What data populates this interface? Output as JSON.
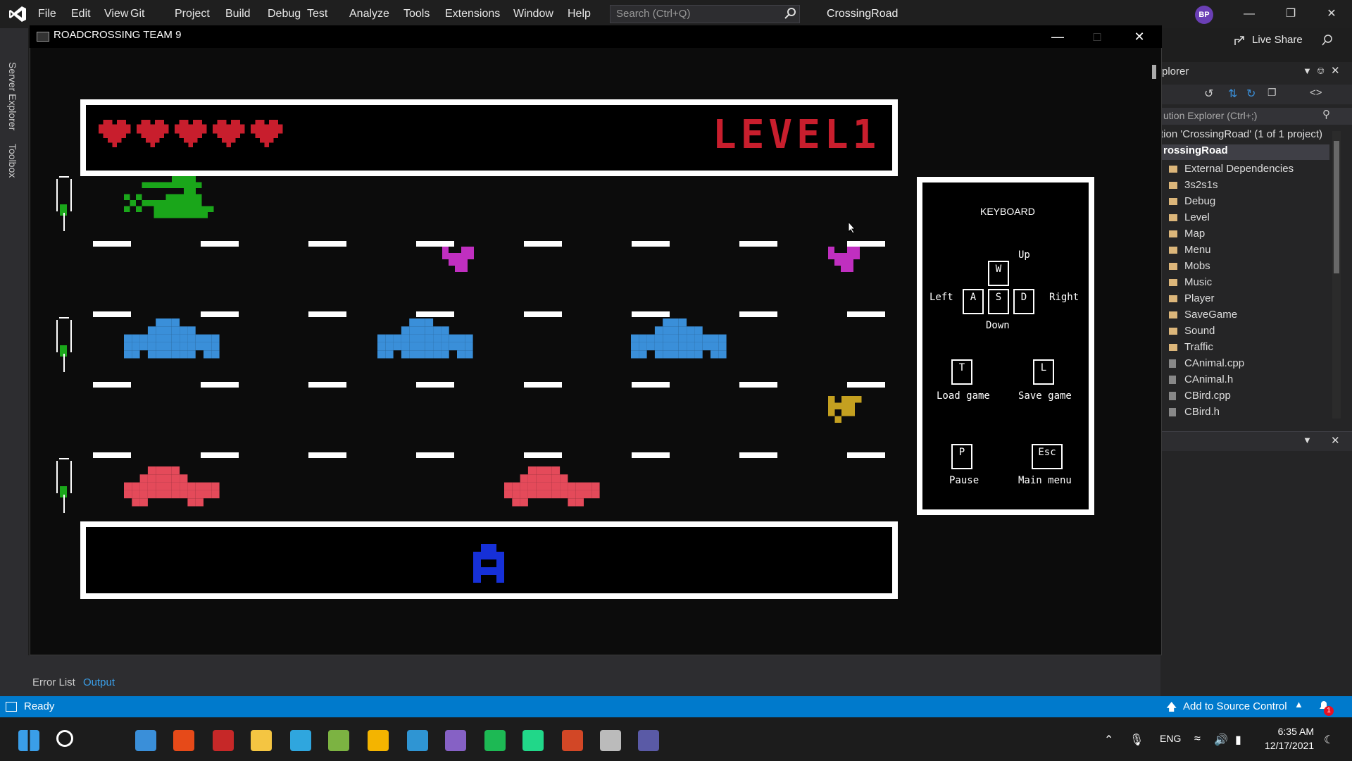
{
  "vs": {
    "menu": [
      "File",
      "Edit",
      "View",
      "Git",
      "Project",
      "Build",
      "Debug",
      "Test",
      "Analyze",
      "Tools",
      "Extensions",
      "Window",
      "Help"
    ],
    "search_placeholder": "Search (Ctrl+Q)",
    "solution_name": "CrossingRoad",
    "user_initials": "BP",
    "live_share": "Live Share",
    "side_tabs": [
      "Server Explorer",
      "Toolbox"
    ]
  },
  "console": {
    "title": "ROADCROSSING TEAM 9"
  },
  "game": {
    "hearts": 5,
    "level_label": "LEVEL1",
    "colors": {
      "heart": "#c81e2d",
      "helicopter": "#1aa61a",
      "bird": "#c02fc0",
      "blue_car": "#3a8fd9",
      "red_car": "#e44a5a",
      "player": "#1630d8",
      "animal": "#c4a020"
    }
  },
  "keyboard": {
    "title": "KEYBOARD",
    "up": "Up",
    "down": "Down",
    "left": "Left",
    "right": "Right",
    "keys": {
      "w": "W",
      "a": "A",
      "s": "S",
      "d": "D",
      "t": "T",
      "l": "L",
      "p": "P",
      "esc": "Esc"
    },
    "load": "Load game",
    "save": "Save game",
    "pause": "Pause",
    "main_menu": "Main menu"
  },
  "solution_explorer": {
    "header": "plorer",
    "search": "ution Explorer (Ctrl+;)",
    "root": "tion 'CrossingRoad' (1 of 1 project)",
    "project": "rossingRoad",
    "items": [
      {
        "label": "External Dependencies",
        "type": "folder"
      },
      {
        "label": "3s2s1s",
        "type": "folder"
      },
      {
        "label": "Debug",
        "type": "folder"
      },
      {
        "label": "Level",
        "type": "folder"
      },
      {
        "label": "Map",
        "type": "folder"
      },
      {
        "label": "Menu",
        "type": "folder"
      },
      {
        "label": "Mobs",
        "type": "folder"
      },
      {
        "label": "Music",
        "type": "folder"
      },
      {
        "label": "Player",
        "type": "folder"
      },
      {
        "label": "SaveGame",
        "type": "folder"
      },
      {
        "label": "Sound",
        "type": "folder"
      },
      {
        "label": "Traffic",
        "type": "folder"
      },
      {
        "label": "CAnimal.cpp",
        "type": "file"
      },
      {
        "label": "CAnimal.h",
        "type": "file"
      },
      {
        "label": "CBird.cpp",
        "type": "file"
      },
      {
        "label": "CBird.h",
        "type": "file"
      }
    ]
  },
  "output": {
    "tabs": [
      "Error List",
      "Output"
    ]
  },
  "status": {
    "ready": "Ready",
    "source_control": "Add to Source Control",
    "notification_count": "1"
  },
  "taskbar": {
    "lang": "ENG",
    "time": "6:35 AM",
    "date": "12/17/2021"
  }
}
